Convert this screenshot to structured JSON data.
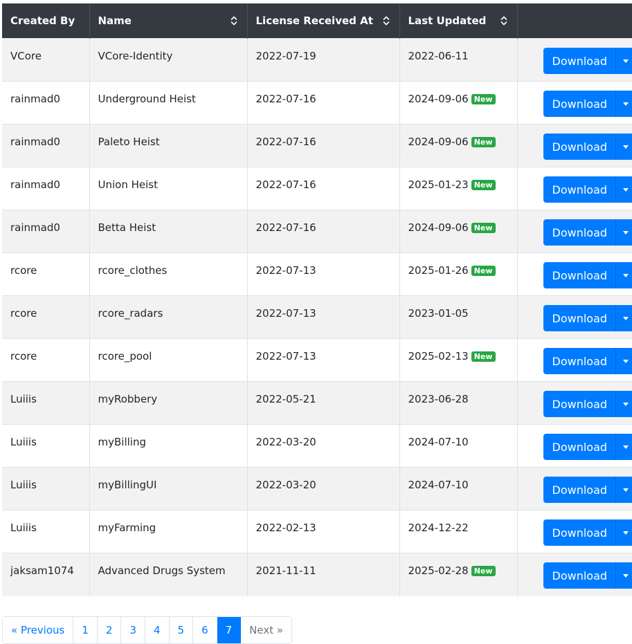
{
  "table": {
    "columns": [
      {
        "label": "Created By",
        "sortable": false
      },
      {
        "label": "Name",
        "sortable": true
      },
      {
        "label": "License Received At",
        "sortable": true
      },
      {
        "label": "Last Updated",
        "sortable": true
      },
      {
        "label": "",
        "sortable": false
      }
    ],
    "rows": [
      {
        "created_by": "VCore",
        "name": "VCore-Identity",
        "license": "2022-07-19",
        "updated": "2022-06-11",
        "is_new": false
      },
      {
        "created_by": "rainmad0",
        "name": "Underground Heist",
        "license": "2022-07-16",
        "updated": "2024-09-06",
        "is_new": true
      },
      {
        "created_by": "rainmad0",
        "name": "Paleto Heist",
        "license": "2022-07-16",
        "updated": "2024-09-06",
        "is_new": true
      },
      {
        "created_by": "rainmad0",
        "name": "Union Heist",
        "license": "2022-07-16",
        "updated": "2025-01-23",
        "is_new": true
      },
      {
        "created_by": "rainmad0",
        "name": "Betta Heist",
        "license": "2022-07-16",
        "updated": "2024-09-06",
        "is_new": true
      },
      {
        "created_by": "rcore",
        "name": "rcore_clothes",
        "license": "2022-07-13",
        "updated": "2025-01-26",
        "is_new": true
      },
      {
        "created_by": "rcore",
        "name": "rcore_radars",
        "license": "2022-07-13",
        "updated": "2023-01-05",
        "is_new": false
      },
      {
        "created_by": "rcore",
        "name": "rcore_pool",
        "license": "2022-07-13",
        "updated": "2025-02-13",
        "is_new": true
      },
      {
        "created_by": "Luiiis",
        "name": "myRobbery",
        "license": "2022-05-21",
        "updated": "2023-06-28",
        "is_new": false
      },
      {
        "created_by": "Luiiis",
        "name": "myBilling",
        "license": "2022-03-20",
        "updated": "2024-07-10",
        "is_new": false
      },
      {
        "created_by": "Luiiis",
        "name": "myBillingUI",
        "license": "2022-03-20",
        "updated": "2024-07-10",
        "is_new": false
      },
      {
        "created_by": "Luiiis",
        "name": "myFarming",
        "license": "2022-02-13",
        "updated": "2024-12-22",
        "is_new": false
      },
      {
        "created_by": "jaksam1074",
        "name": "Advanced Drugs System",
        "license": "2021-11-11",
        "updated": "2025-02-28",
        "is_new": true
      }
    ],
    "new_badge_label": "New",
    "download_label": "Download"
  },
  "pagination": {
    "previous_label": "« Previous",
    "pages": [
      "1",
      "2",
      "3",
      "4",
      "5",
      "6",
      "7"
    ],
    "active_page": "7",
    "next_label": "Next »"
  },
  "colors": {
    "header_bg": "#343a40",
    "primary": "#007bff",
    "badge_new": "#28a745"
  }
}
